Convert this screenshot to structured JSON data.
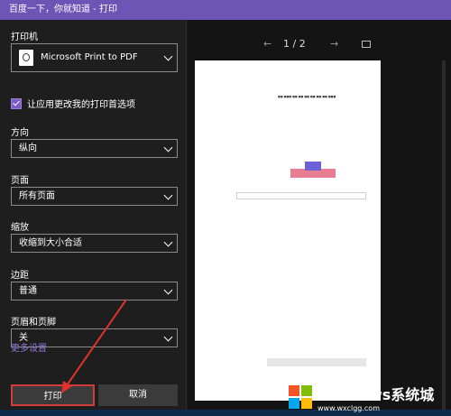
{
  "window": {
    "title": "百度一下，你就知道 - 打印"
  },
  "left_panel": {
    "printer_label": "打印机",
    "printer_value": "Microsoft Print to PDF",
    "checkbox_label": "让应用更改我的打印首选项",
    "orientation_label": "方向",
    "orientation_value": "纵向",
    "pages_label": "页面",
    "pages_value": "所有页面",
    "scale_label": "缩放",
    "scale_value": "收缩到大小合适",
    "margins_label": "边距",
    "margins_value": "普通",
    "header_footer_label": "页眉和页脚",
    "header_footer_value": "关",
    "more_settings": "更多设置",
    "print_button": "打印",
    "cancel_button": "取消"
  },
  "preview": {
    "page_indicator": "1 / 2",
    "prev_symbol": "←",
    "next_symbol": "→"
  },
  "colors": {
    "titlebar": "#6c55b5",
    "accent": "#7b5cc4",
    "highlight": "#d23b3b"
  },
  "watermark": {
    "brand": "Windows系统城",
    "url": "www.wxclgg.com"
  }
}
